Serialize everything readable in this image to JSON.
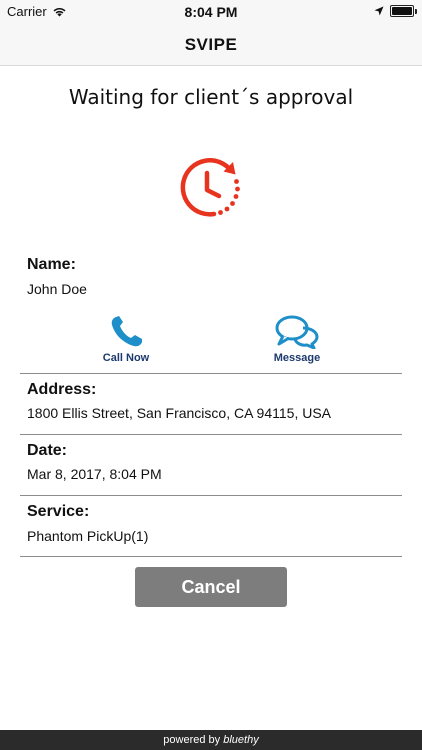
{
  "status_bar": {
    "carrier": "Carrier",
    "time": "8:04 PM",
    "battery_level": 1.0
  },
  "nav": {
    "title": "SVIPE"
  },
  "heading": "Waiting for client´s approval",
  "client": {
    "name_label": "Name:",
    "name": "John Doe"
  },
  "actions": {
    "call_label": "Call Now",
    "message_label": "Message"
  },
  "address": {
    "label": "Address:",
    "value": "1800 Ellis Street, San Francisco, CA 94115, USA"
  },
  "date": {
    "label": "Date:",
    "value": "Mar 8, 2017, 8:04 PM"
  },
  "service": {
    "label": "Service:",
    "value": "Phantom PickUp(1)"
  },
  "cancel_label": "Cancel",
  "footer": {
    "prefix": "powered by",
    "brand": "bluethy"
  },
  "colors": {
    "accent_red": "#e8331f",
    "icon_blue": "#1e8fc8",
    "button_gray": "#7d7d7d"
  }
}
